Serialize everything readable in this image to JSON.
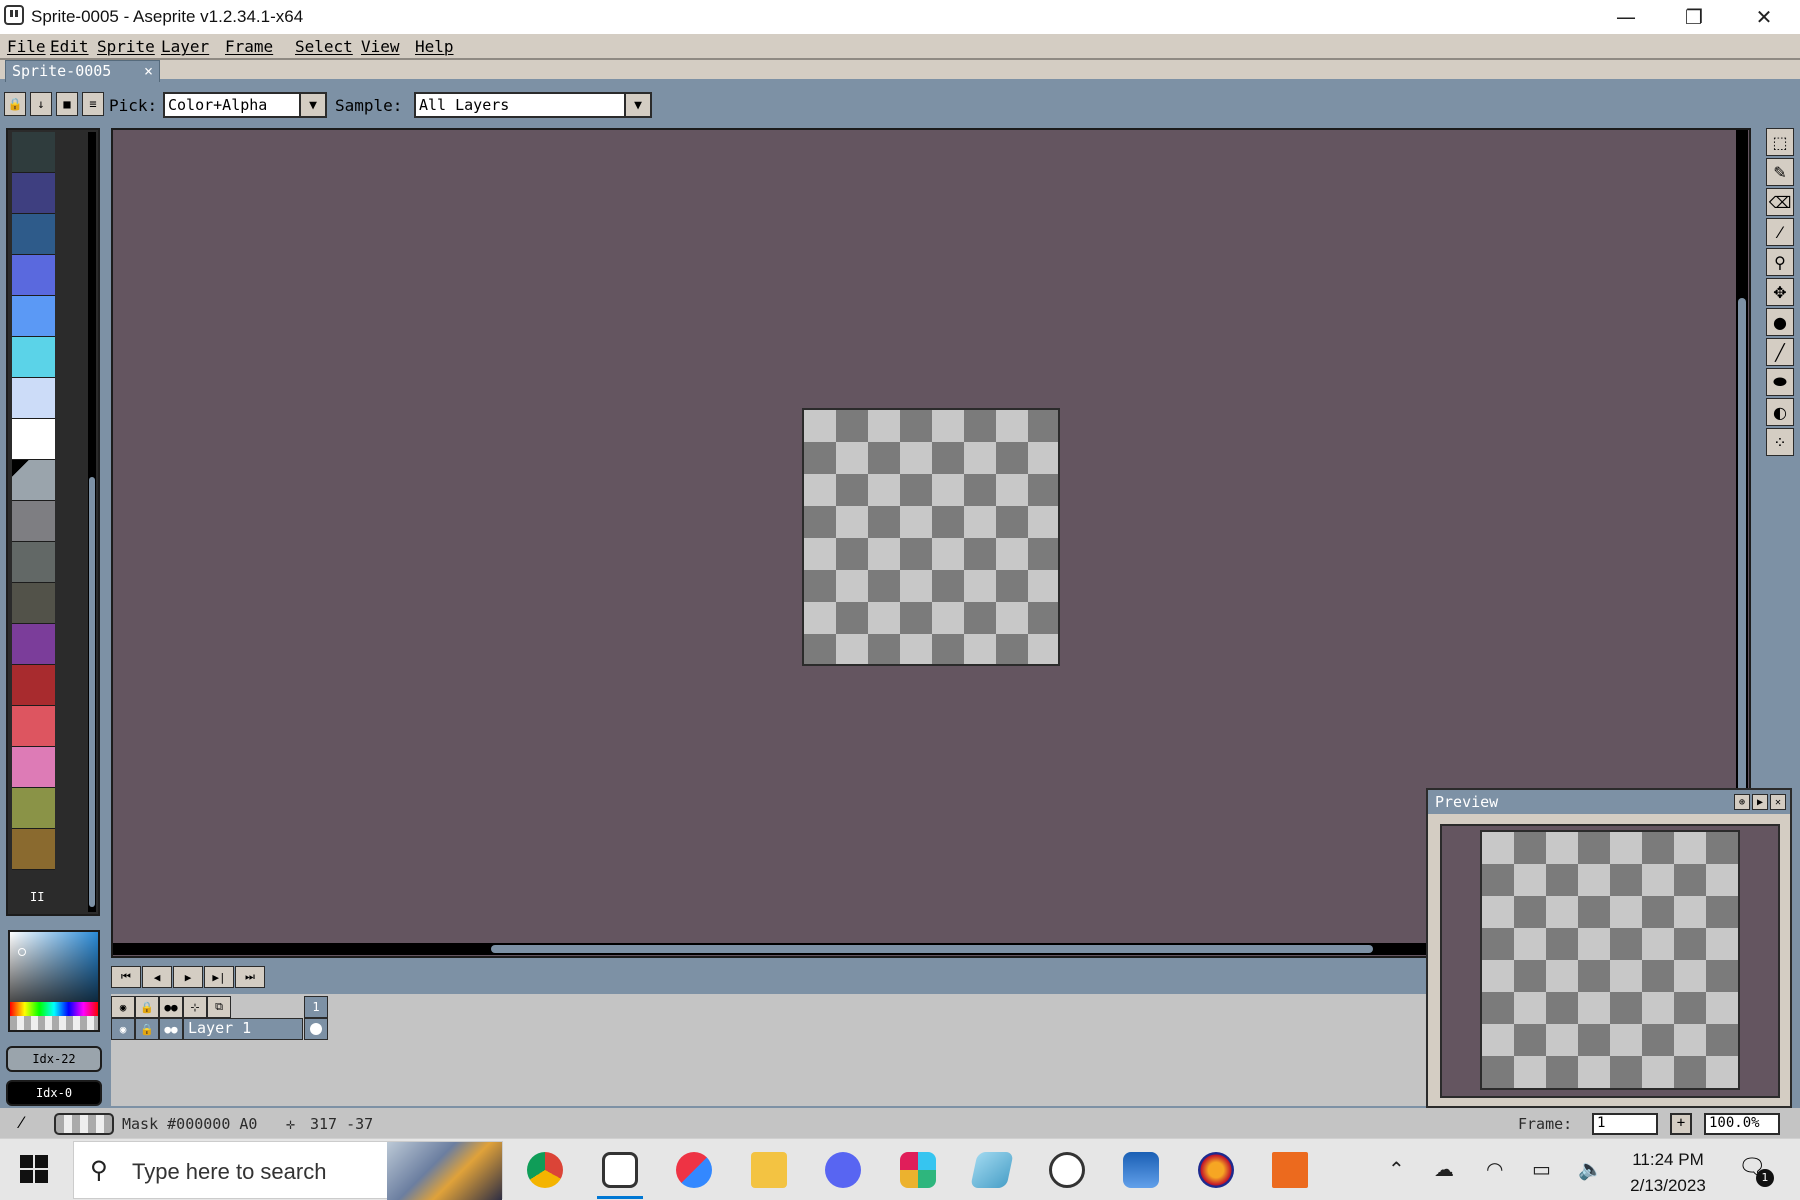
{
  "window": {
    "title": "Sprite-0005 - Aseprite v1.2.34.1-x64",
    "minimize_glyph": "—",
    "maximize_glyph": "❐",
    "close_glyph": "✕"
  },
  "menu": [
    "File",
    "Edit",
    "Sprite",
    "Layer",
    "Frame",
    "Select",
    "View",
    "Help"
  ],
  "tab": {
    "label": "Sprite-0005",
    "close_glyph": "×"
  },
  "context_bar": {
    "pick_label": "Pick:",
    "pick_value": "Color+Alpha",
    "sample_label": "Sample:",
    "sample_value": "All Layers"
  },
  "palette": {
    "colors": [
      "#2f3c3d",
      "#3e3f80",
      "#2e5b8a",
      "#5a69de",
      "#5b99f5",
      "#5bd3e8",
      "#ccdcf8",
      "#ffffff",
      "#9aa4ac",
      "#7e7e82",
      "#626866",
      "#525249",
      "#7b3d9a",
      "#a82b2e",
      "#dd5560",
      "#dd7bb6",
      "#8a9347",
      "#8a6a2f"
    ],
    "grip": "II"
  },
  "color_indices": {
    "foreground": "Idx-22",
    "background": "Idx-0"
  },
  "tools": [
    "marquee-icon",
    "pencil-icon",
    "eraser-icon",
    "eyedropper-icon",
    "zoom-icon",
    "move-icon",
    "paint-bucket-icon",
    "line-icon",
    "ellipse-icon",
    "blur-icon",
    "spray-icon"
  ],
  "timeline": {
    "frame_header": "1",
    "layer_name": "Layer 1"
  },
  "preview": {
    "title": "Preview"
  },
  "status": {
    "mask_text": "Mask #000000 A0",
    "coords": "317 -37",
    "frame_label": "Frame:",
    "frame_value": "1",
    "zoom_value": "100.0%"
  },
  "taskbar": {
    "search_placeholder": "Type here to search",
    "time": "11:24 PM",
    "date": "2/13/2023",
    "notification_count": "1"
  }
}
